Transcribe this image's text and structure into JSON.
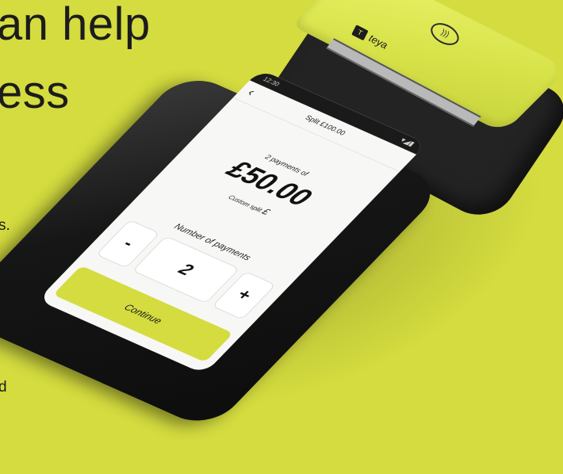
{
  "headline": {
    "line1": "an help",
    "line2": "ess"
  },
  "body_fragments": {
    "line1": "s.",
    "line2": "d"
  },
  "device": {
    "brand_name": "teya",
    "brand_logo": "T",
    "nfc_icon": "contactless-icon",
    "status": {
      "time": "12:30",
      "icons": "▾◢▮"
    },
    "nav": {
      "back_icon": "‹",
      "title": "Split £100.00"
    },
    "summary_label": "2 payments of",
    "amount": "£50.00",
    "custom_split": {
      "label": "Custom split",
      "symbol": "£"
    },
    "payments_label": "Number of payments",
    "stepper": {
      "decrement": "-",
      "value": "2",
      "increment": "+"
    },
    "continue_label": "Continue"
  },
  "colors": {
    "accent": "#d4dc3f",
    "device_body": "#1a1a1a"
  }
}
